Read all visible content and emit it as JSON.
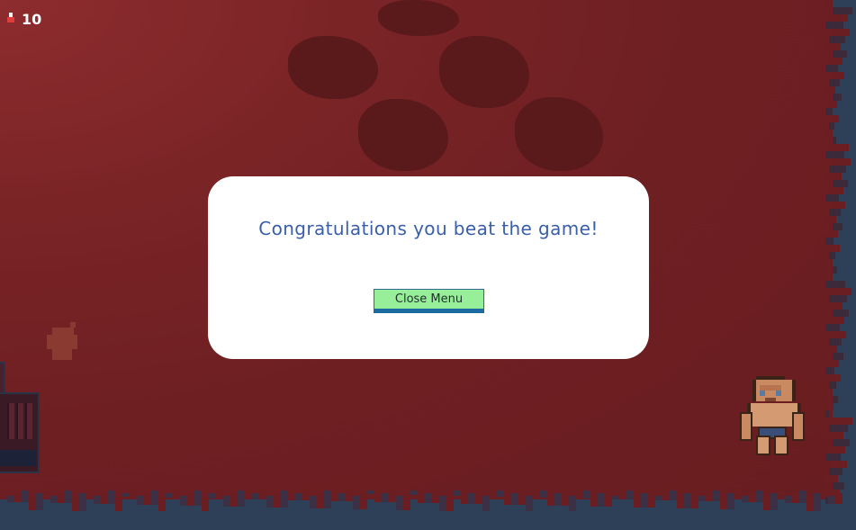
{
  "hud": {
    "icon": "potion-icon",
    "value": "10"
  },
  "dialog": {
    "message": "Congratulations you beat the game!",
    "close_label": "Close Menu"
  },
  "colors": {
    "floor": "#6e1f22",
    "wall": "#2e3f58",
    "dialog_text": "#3a5fa8",
    "button_fill": "#98ef9a",
    "button_border": "#1c6aa0"
  }
}
